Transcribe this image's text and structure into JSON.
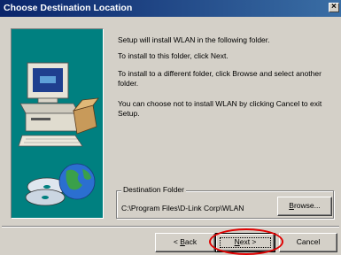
{
  "window": {
    "title": "Choose Destination Location",
    "close_glyph": "×"
  },
  "art": {
    "icon": "computer-and-disc-graphic"
  },
  "body": {
    "line1": "Setup will install WLAN in the following folder.",
    "line2": "To install to this folder, click Next.",
    "line3": "To install to a different folder, click Browse and select another folder.",
    "line4": "You can choose not to install WLAN by clicking Cancel to exit Setup."
  },
  "destination": {
    "group_label": "Destination Folder",
    "path": "C:\\Program Files\\D-Link Corp\\WLAN",
    "browse_prefix": "B",
    "browse_rest": "rowse..."
  },
  "buttons": {
    "back_prefix": "< ",
    "back_mnemonic": "B",
    "back_rest": "ack",
    "next_mnemonic": "N",
    "next_rest": "ext >",
    "cancel": "Cancel"
  },
  "colors": {
    "titlebar": "#0a246a",
    "panel": "#008080",
    "annotation": "#e00000"
  }
}
